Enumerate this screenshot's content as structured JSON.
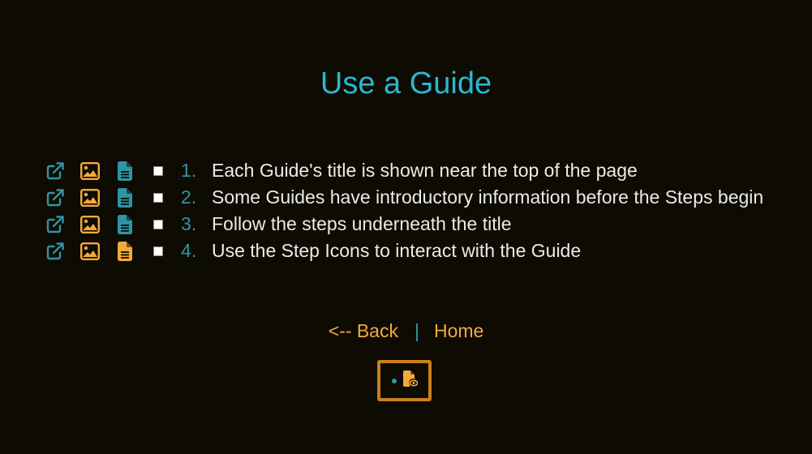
{
  "page": {
    "title": "Use a Guide"
  },
  "colors": {
    "background": "#0d0b02",
    "title": "#2bb7cf",
    "teal": "#2f95a4",
    "orange": "#f5a93a",
    "badge_border": "#c8811a",
    "step_text": "#ecebe6"
  },
  "steps": [
    {
      "number": "1.",
      "text": "Each Guide's title is shown near the top of the page",
      "doc_icon_color": "teal"
    },
    {
      "number": "2.",
      "text": "Some Guides have introductory information before the Steps begin",
      "doc_icon_color": "teal"
    },
    {
      "number": "3.",
      "text": "Follow the steps underneath the title",
      "doc_icon_color": "teal"
    },
    {
      "number": "4.",
      "text": "Use the Step Icons to interact with the Guide",
      "doc_icon_color": "orange"
    }
  ],
  "step_icons": {
    "link": "external-link-icon",
    "image": "image-icon",
    "document": "document-icon"
  },
  "nav": {
    "back_label": "<-- Back",
    "separator": "|",
    "home_label": "Home"
  },
  "badge": {
    "icon": "file-view-icon"
  }
}
